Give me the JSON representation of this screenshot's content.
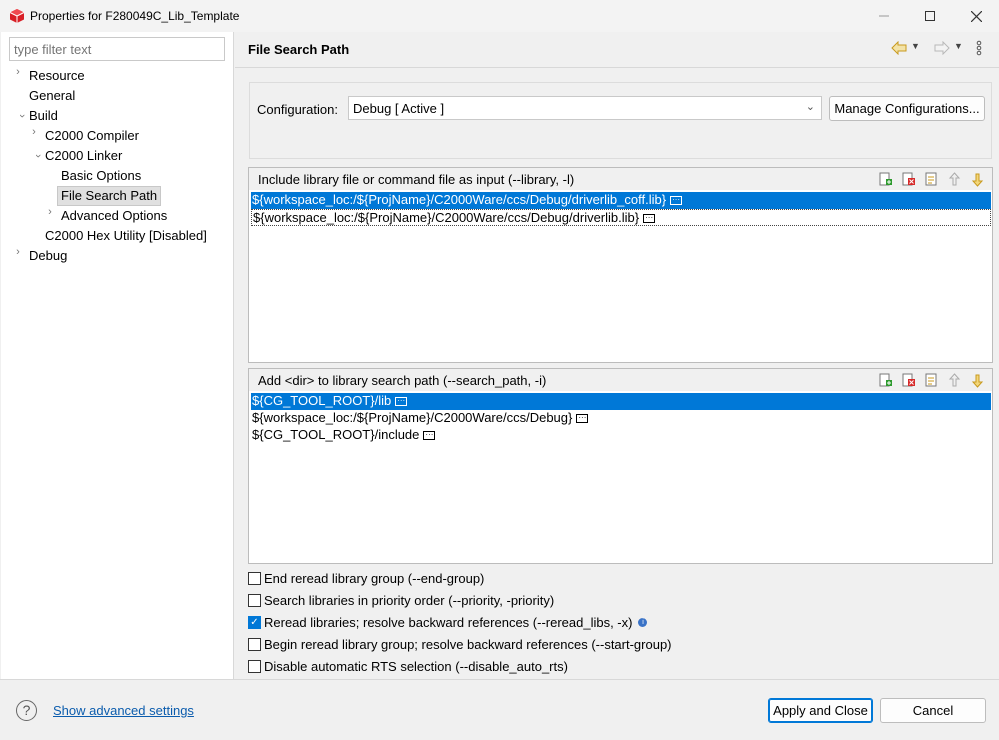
{
  "window": {
    "title": "Properties for F280049C_Lib_Template",
    "icons": {
      "app": "ccs-app-icon",
      "minimize": "minimize-icon",
      "maximize": "maximize-icon",
      "close": "close-icon"
    }
  },
  "sidebar": {
    "filter_placeholder": "type filter text",
    "items": [
      {
        "label": "Resource",
        "expanded": false,
        "level": 0
      },
      {
        "label": "General",
        "level": 0
      },
      {
        "label": "Build",
        "expanded": true,
        "level": 0
      },
      {
        "label": "C2000 Compiler",
        "expanded": false,
        "level": 1
      },
      {
        "label": "C2000 Linker",
        "expanded": true,
        "level": 1
      },
      {
        "label": "Basic Options",
        "level": 2
      },
      {
        "label": "File Search Path",
        "level": 2,
        "selected": true
      },
      {
        "label": "Advanced Options",
        "expanded": false,
        "level": 2
      },
      {
        "label": "C2000 Hex Utility  [Disabled]",
        "level": 1
      },
      {
        "label": "Debug",
        "expanded": false,
        "level": 0
      }
    ]
  },
  "main": {
    "title": "File Search Path",
    "configuration": {
      "label": "Configuration:",
      "value": "Debug  [ Active ]",
      "manage_button": "Manage Configurations..."
    },
    "library_files": {
      "label": "Include library file or command file as input (--library, -l)",
      "rows": [
        "${workspace_loc:/${ProjName}/C2000Ware/ccs/Debug/driverlib_coff.lib}",
        "${workspace_loc:/${ProjName}/C2000Ware/ccs/Debug/driverlib.lib}"
      ],
      "selected_index": 0,
      "tools": [
        "add-icon",
        "delete-icon",
        "edit-icon",
        "move-up-icon",
        "move-down-icon"
      ]
    },
    "search_paths": {
      "label": "Add <dir> to library search path (--search_path, -i)",
      "rows": [
        "${CG_TOOL_ROOT}/lib",
        "${workspace_loc:/${ProjName}/C2000Ware/ccs/Debug}",
        "${CG_TOOL_ROOT}/include"
      ],
      "selected_index": 0,
      "tools": [
        "add-icon",
        "delete-icon",
        "edit-icon",
        "move-up-icon",
        "move-down-icon"
      ]
    },
    "options": [
      {
        "label": "End reread library group (--end-group)",
        "checked": false
      },
      {
        "label": "Search libraries in priority order (--priority, -priority)",
        "checked": false
      },
      {
        "label": "Reread libraries; resolve backward references (--reread_libs, -x)",
        "checked": true,
        "info": true
      },
      {
        "label": "Begin reread library group; resolve backward references (--start-group)",
        "checked": false
      },
      {
        "label": "Disable automatic RTS selection (--disable_auto_rts)",
        "checked": false
      }
    ]
  },
  "footer": {
    "advanced_link": "Show advanced settings",
    "apply_button": "Apply and Close",
    "cancel_button": "Cancel"
  },
  "colors": {
    "selection": "#0078d7",
    "link": "#0b5cad",
    "app_icon": "#d81f26"
  }
}
